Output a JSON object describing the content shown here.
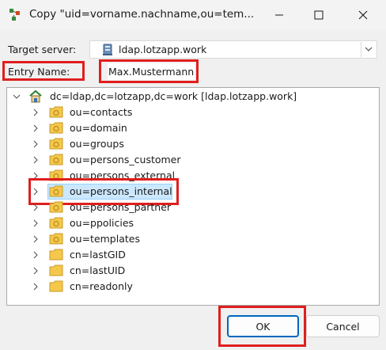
{
  "window": {
    "title": "Copy \"uid=vorname.nachname,ou=tem..."
  },
  "target_server": {
    "label": "Target server:",
    "value": "ldap.lotzapp.work"
  },
  "entry_name": {
    "label": "Entry Name:",
    "value": "Max.Mustermann"
  },
  "tree": {
    "root_label": "dc=ldap,dc=lotzapp,dc=work [ldap.lotzapp.work]",
    "children": [
      {
        "label": "ou=contacts",
        "type": "ou"
      },
      {
        "label": "ou=domain",
        "type": "ou"
      },
      {
        "label": "ou=groups",
        "type": "ou"
      },
      {
        "label": "ou=persons_customer",
        "type": "ou"
      },
      {
        "label": "ou=persons_external",
        "type": "ou"
      },
      {
        "label": "ou=persons_internal",
        "type": "ou",
        "selected": true
      },
      {
        "label": "ou=persons_partner",
        "type": "ou"
      },
      {
        "label": "ou=ppolicies",
        "type": "ou"
      },
      {
        "label": "ou=templates",
        "type": "ou"
      },
      {
        "label": "cn=lastGID",
        "type": "cn"
      },
      {
        "label": "cn=lastUID",
        "type": "cn"
      },
      {
        "label": "cn=readonly",
        "type": "cn"
      }
    ]
  },
  "buttons": {
    "ok": "OK",
    "cancel": "Cancel"
  },
  "colors": {
    "highlight_box": "#e01e1e",
    "selection_bg": "#cce8ff",
    "accent": "#0067c0",
    "folder_yellow": "#f5c84c"
  }
}
